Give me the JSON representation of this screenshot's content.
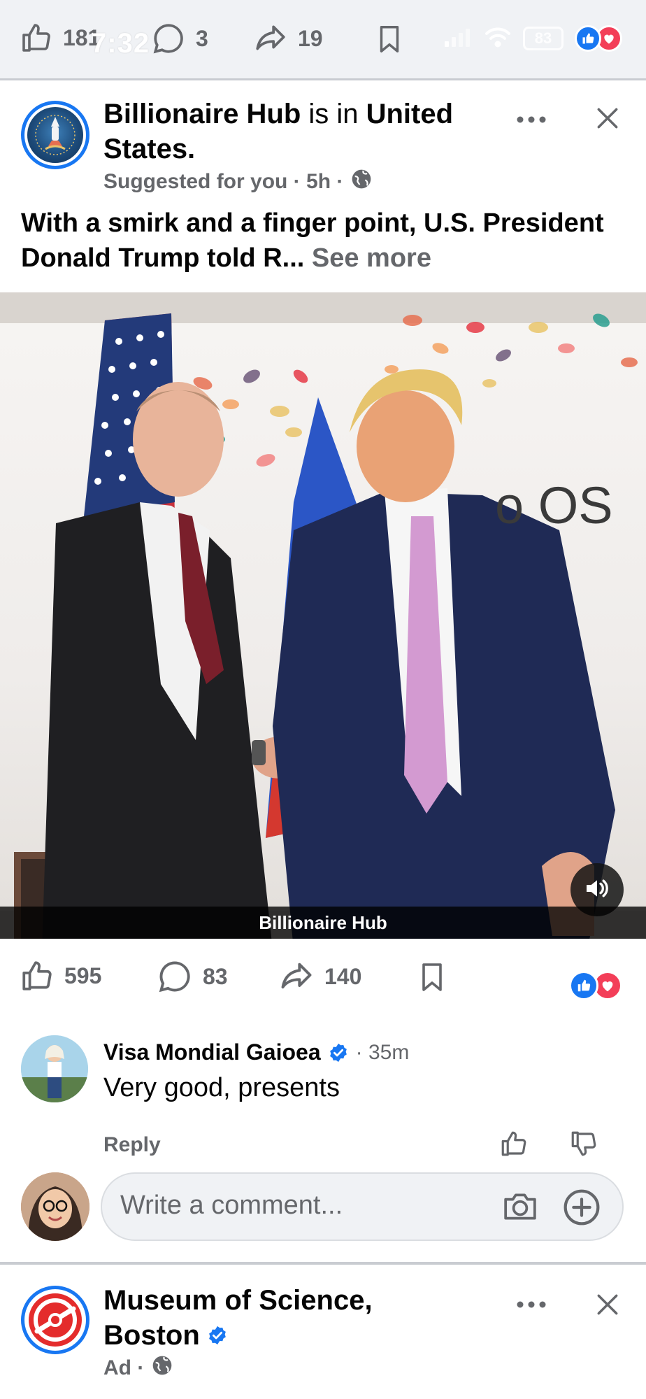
{
  "status_bar": {
    "time": "7:32",
    "battery": "83"
  },
  "top_actions": {
    "likes": "181",
    "comments": "3",
    "shares": "19"
  },
  "post": {
    "page_name": "Billionaire Hub",
    "connector": " is in ",
    "location": "United States.",
    "subtitle": "Suggested for you · 5h ·",
    "text": "With a smirk and a finger point, U.S. President Donald Trump told R...",
    "see_more": " See more",
    "video_caption": "Billionaire Hub",
    "background_text": "o OS",
    "likes": "595",
    "comments": "83",
    "shares": "140"
  },
  "comment": {
    "author": "Visa Mondial Gaioea",
    "time": "· 35m",
    "text": "Very good, presents",
    "reply_label": "Reply"
  },
  "comment_input": {
    "placeholder": "Write a comment..."
  },
  "next_post": {
    "page_name_line1": "Museum of Science,",
    "page_name_line2": "Boston",
    "subtitle": "Ad ·"
  },
  "icons": {
    "like": "thumbs-up-icon",
    "comment": "comment-bubble-icon",
    "share": "share-arrow-icon",
    "save": "bookmark-icon",
    "more": "more-dots-icon",
    "close": "close-x-icon",
    "globe": "globe-icon",
    "sound": "speaker-icon",
    "camera": "camera-icon",
    "add": "plus-circle-icon",
    "verified": "verified-badge-icon"
  },
  "colors": {
    "brand_blue": "#1877f2",
    "love_red": "#f33e58",
    "muted_text": "#65676b"
  }
}
